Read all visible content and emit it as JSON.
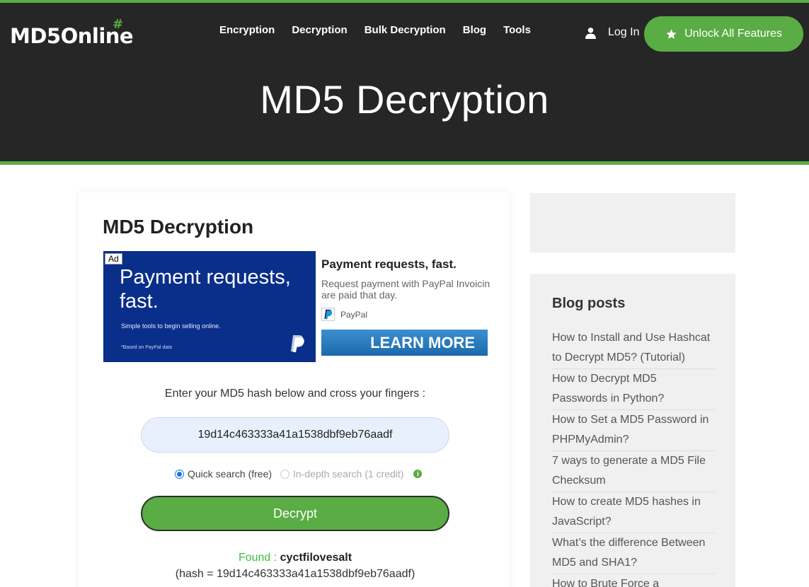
{
  "header": {
    "logo": "MD5Online",
    "logo_mark": "#",
    "nav": [
      "Encryption",
      "Decryption",
      "Bulk Decryption",
      "Blog",
      "Tools"
    ],
    "login": "Log In",
    "unlock": "Unlock All Features",
    "hero_title": "MD5 Decryption"
  },
  "main": {
    "title": "MD5 Decryption",
    "ad": {
      "badge": "Ad",
      "image_headline": "Payment requests, fast.",
      "image_sub": "Simple tools to begin selling online.",
      "image_note": "*Based on PayPal data",
      "headline": "Payment requests, fast.",
      "description": "Request payment with PayPal Invoicin are paid that day.",
      "brand": "PayPal",
      "cta": "LEARN MORE"
    },
    "prompt": "Enter your MD5 hash below and cross your fingers :",
    "hash_value": "19d14c463333a41a1538dbf9eb76aadf",
    "options": {
      "quick": "Quick search (free)",
      "indepth": "In-depth search (1 credit)"
    },
    "decrypt_label": "Decrypt",
    "result": {
      "found_label": "Found :",
      "found_value": "cyctfilovesalt",
      "hash_line": "(hash = 19d14c463333a41a1538dbf9eb76aadf)"
    }
  },
  "sidebar": {
    "title": "Blog posts",
    "posts": [
      "How to Install and Use Hashcat to Decrypt MD5? (Tutorial)",
      "How to Decrypt MD5 Passwords in Python?",
      "How to Set a MD5 Password in PHPMyAdmin?",
      "7 ways to generate a MD5 File Checksum",
      "How to create MD5 hashes in JavaScript?",
      "What’s the difference Between MD5 and SHA1?",
      "How to Brute Force a Password?"
    ]
  },
  "colors": {
    "brand_green": "#5aac44",
    "header_dark": "#262626",
    "ad_blue": "#0a2f8a"
  }
}
